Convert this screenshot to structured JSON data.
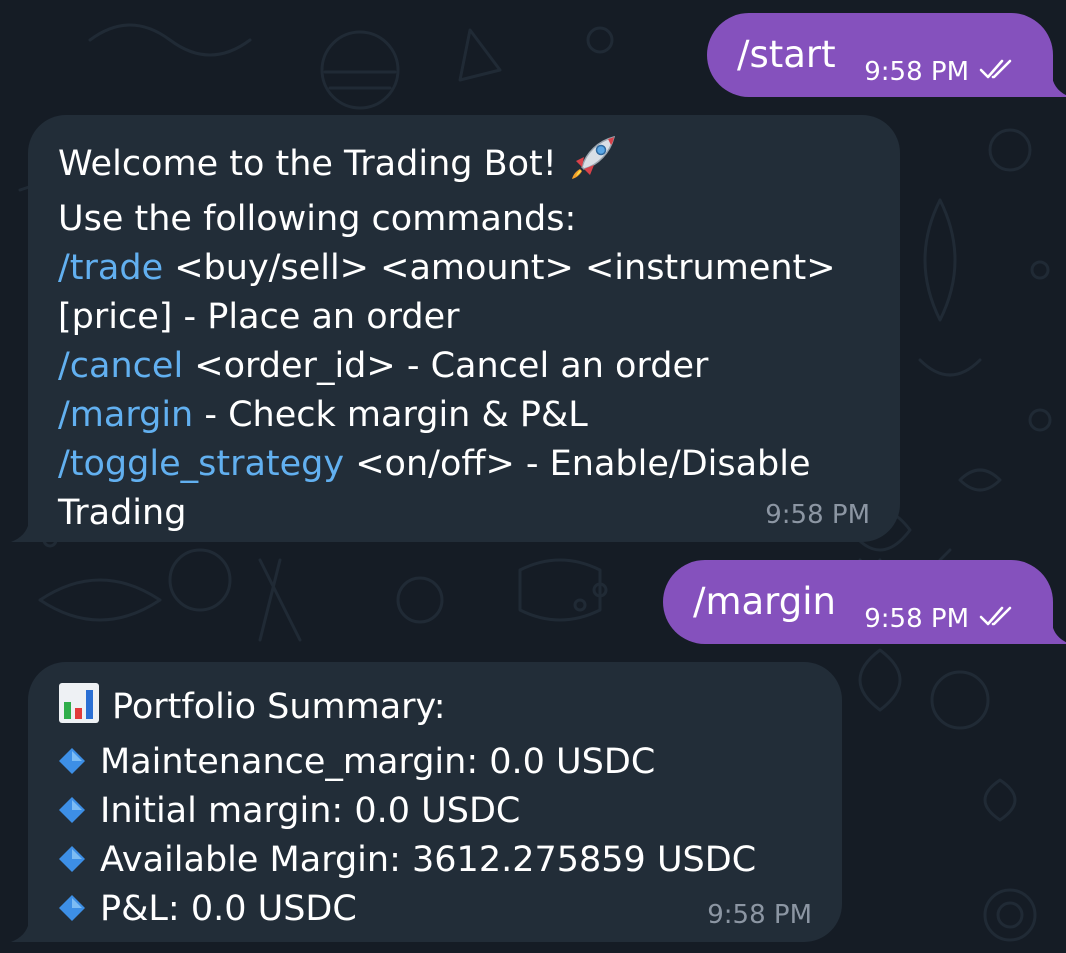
{
  "messages": [
    {
      "id": "start-cmd",
      "direction": "outgoing",
      "text": "/start",
      "time": "9:58 PM",
      "status_icon": "double-check-icon"
    },
    {
      "id": "welcome-reply",
      "direction": "incoming",
      "lines": [
        {
          "text": "Welcome to the Trading Bot!",
          "emoji": "rocket-icon"
        },
        {
          "text": "Use the following commands:"
        },
        {
          "cmd": "/trade",
          "text": " <buy/sell> <amount> <instrument>"
        },
        {
          "text": "[price] - Place an order"
        },
        {
          "cmd": "/cancel",
          "text": " <order_id> - Cancel an order"
        },
        {
          "cmd": "/margin",
          "text": " - Check margin & P&L"
        },
        {
          "cmd": "/toggle_strategy",
          "text": " <on/off> - Enable/Disable"
        },
        {
          "text": "Trading"
        }
      ],
      "time": "9:58 PM"
    },
    {
      "id": "margin-cmd",
      "direction": "outgoing",
      "text": "/margin",
      "time": "9:58 PM",
      "status_icon": "double-check-icon"
    },
    {
      "id": "portfolio-reply",
      "direction": "incoming",
      "lines": [
        {
          "emoji": "bar-chart-icon",
          "text": "Portfolio Summary:"
        },
        {
          "emoji": "blue-diamond-icon",
          "text": "Maintenance_margin: 0.0 USDC"
        },
        {
          "emoji": "blue-diamond-icon",
          "text": "Initial margin: 0.0 USDC"
        },
        {
          "emoji": "blue-diamond-icon",
          "text": "Available Margin: 3612.275859 USDC"
        },
        {
          "emoji": "blue-diamond-icon",
          "text": "P&L: 0.0 USDC"
        }
      ],
      "time": "9:58 PM"
    }
  ],
  "colors": {
    "background": "#151c25",
    "outgoing_bubble": "#8551bd",
    "incoming_bubble": "#222d38",
    "command_link": "#62b0f0",
    "timestamp_incoming": "#8c96a3"
  }
}
